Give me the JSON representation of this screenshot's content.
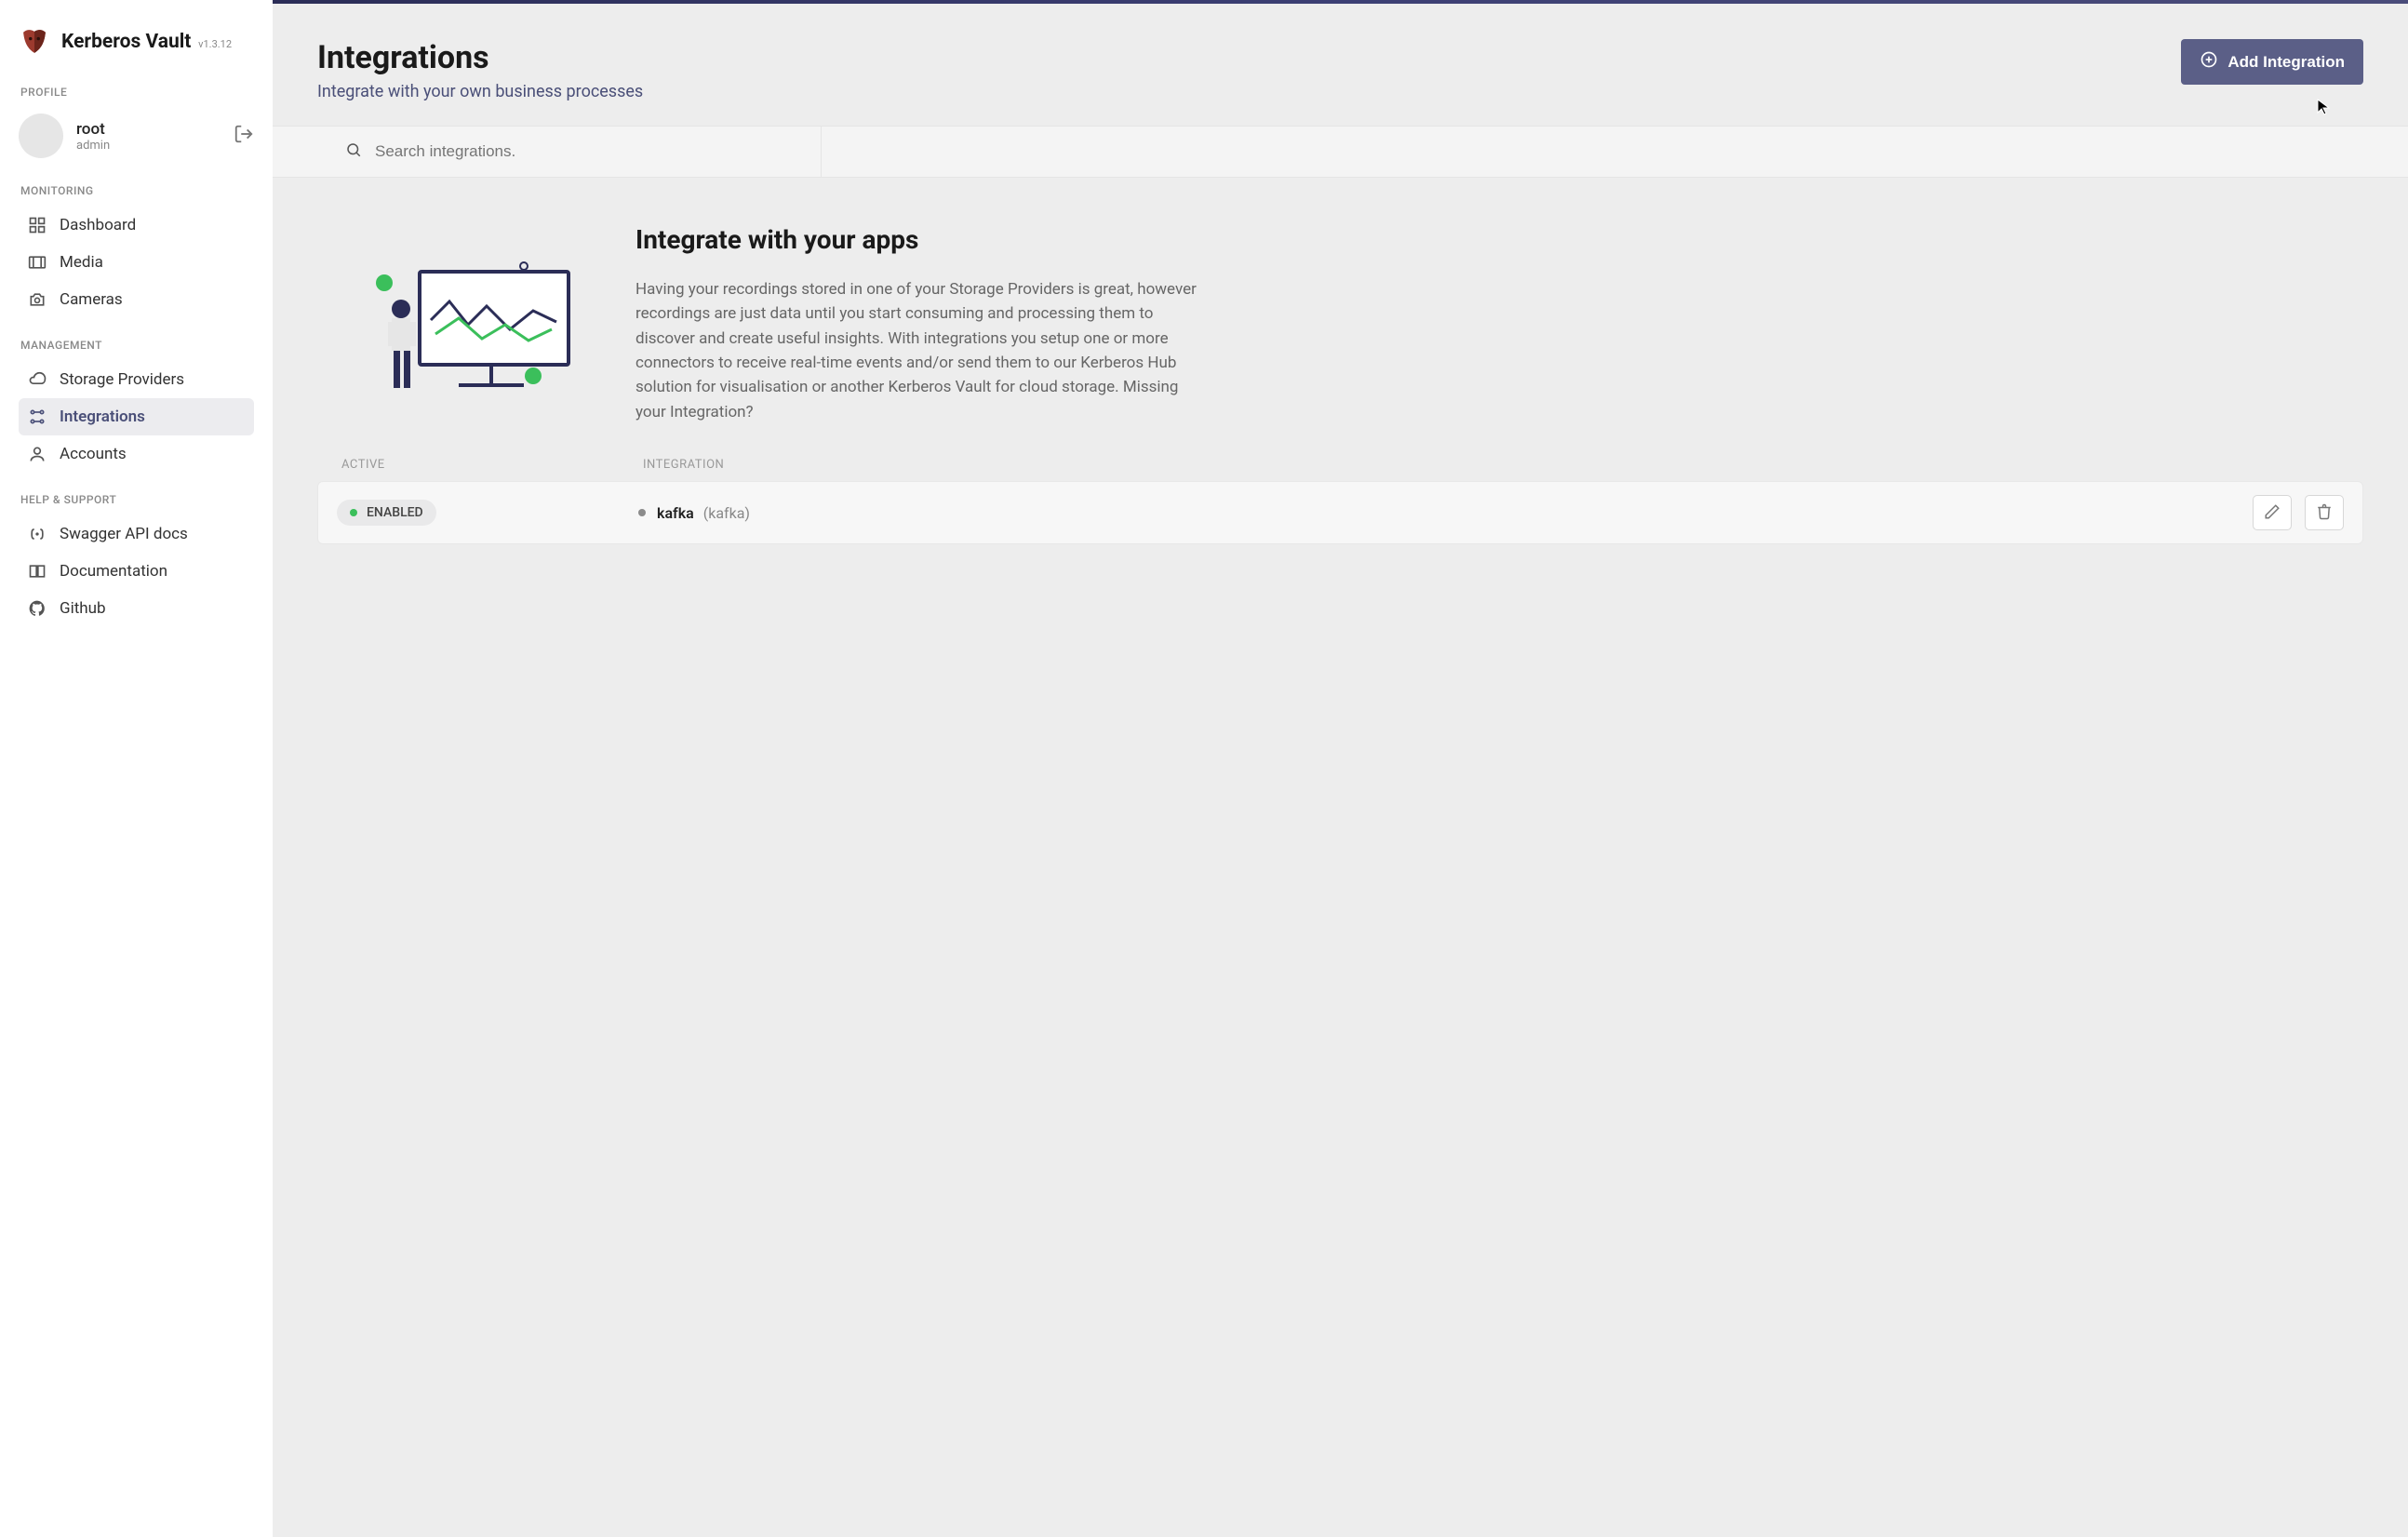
{
  "brand": {
    "name": "Kerberos Vault",
    "version": "v1.3.12"
  },
  "sections": {
    "profile": "PROFILE",
    "monitoring": "MONITORING",
    "management": "MANAGEMENT",
    "help": "HELP & SUPPORT"
  },
  "profile": {
    "username": "root",
    "role": "admin"
  },
  "nav": {
    "monitoring": [
      {
        "label": "Dashboard"
      },
      {
        "label": "Media"
      },
      {
        "label": "Cameras"
      }
    ],
    "management": [
      {
        "label": "Storage Providers"
      },
      {
        "label": "Integrations"
      },
      {
        "label": "Accounts"
      }
    ],
    "help": [
      {
        "label": "Swagger API docs"
      },
      {
        "label": "Documentation"
      },
      {
        "label": "Github"
      }
    ]
  },
  "page": {
    "title": "Integrations",
    "subtitle": "Integrate with your own business processes",
    "add_btn": "Add Integration",
    "search_placeholder": "Search integrations."
  },
  "intro": {
    "heading": "Integrate with your apps",
    "body": "Having your recordings stored in one of your Storage Providers is great, however recordings are just data until you start consuming and processing them to discover and create useful insights. With integrations you setup one or more connectors to receive real-time events and/or send them to our Kerberos Hub solution for visualisation or another Kerberos Vault for cloud storage. Missing your Integration?"
  },
  "table": {
    "headers": {
      "active": "ACTIVE",
      "integration": "INTEGRATION"
    },
    "rows": [
      {
        "status": "ENABLED",
        "name": "kafka",
        "type": "(kafka)"
      }
    ]
  }
}
